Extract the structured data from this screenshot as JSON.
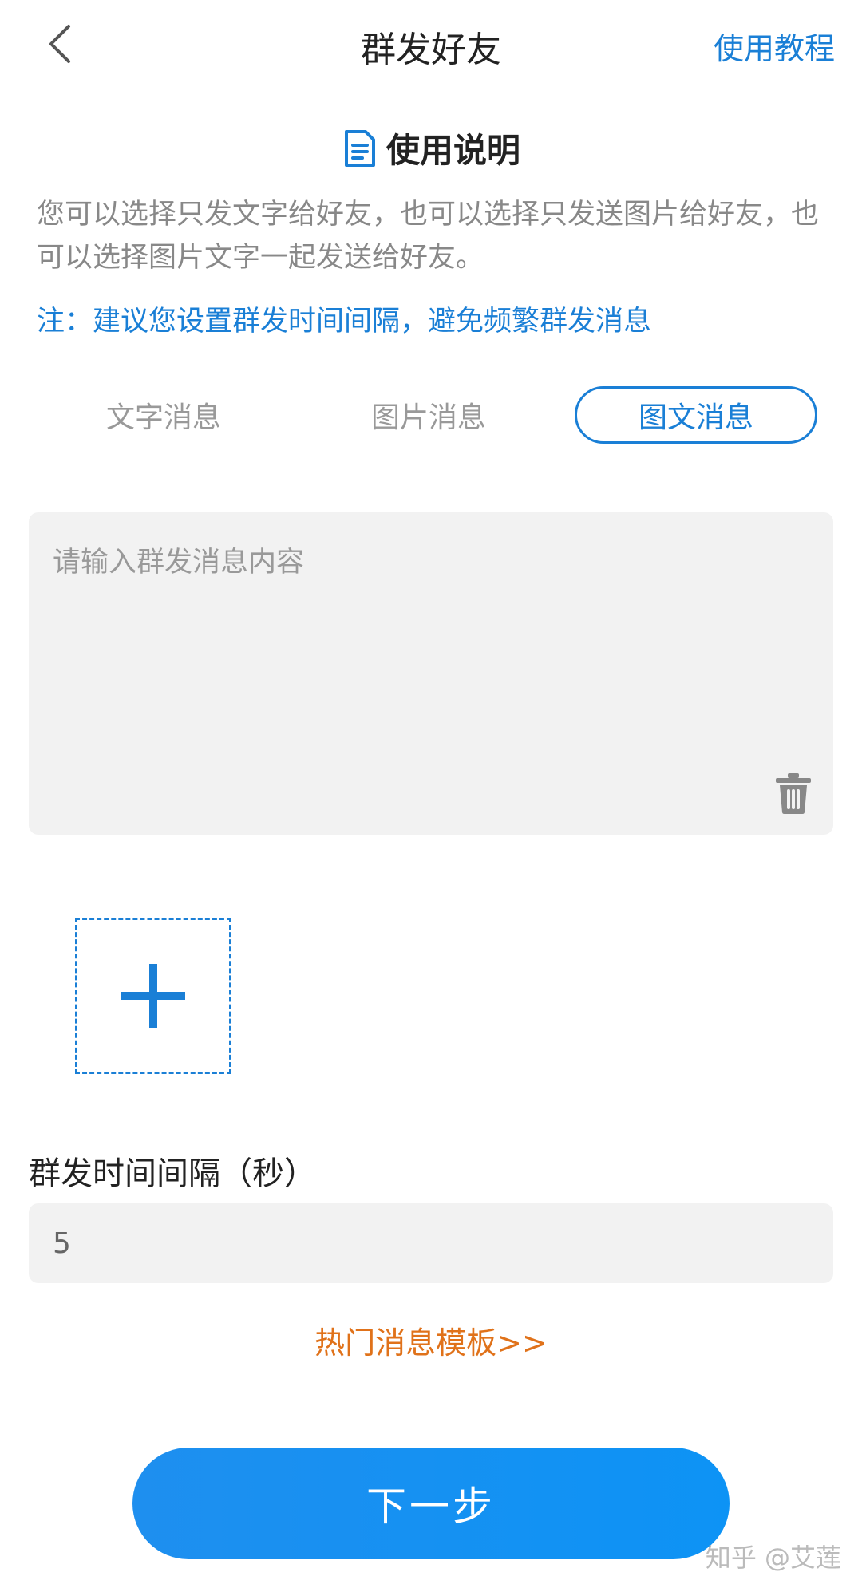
{
  "header": {
    "title": "群发好友",
    "help_link": "使用教程"
  },
  "instructions": {
    "title": "使用说明",
    "description": "您可以选择只发文字给好友，也可以选择只发送图片给好友，也可以选择图片文字一起发送给好友。",
    "note": "注：建议您设置群发时间间隔，避免频繁群发消息"
  },
  "tabs": [
    {
      "label": "文字消息",
      "selected": false
    },
    {
      "label": "图片消息",
      "selected": false
    },
    {
      "label": "图文消息",
      "selected": true
    }
  ],
  "message": {
    "placeholder": "请输入群发消息内容",
    "value": ""
  },
  "interval": {
    "label": "群发时间间隔（秒）",
    "value": "5"
  },
  "template_link": "热门消息模板>>",
  "next_button": "下一步",
  "watermark": "知乎 @艾莲",
  "colors": {
    "accent": "#1a7fd6",
    "button": "#0d93f5",
    "template_link": "#e0721a",
    "input_bg": "#f2f2f2"
  }
}
